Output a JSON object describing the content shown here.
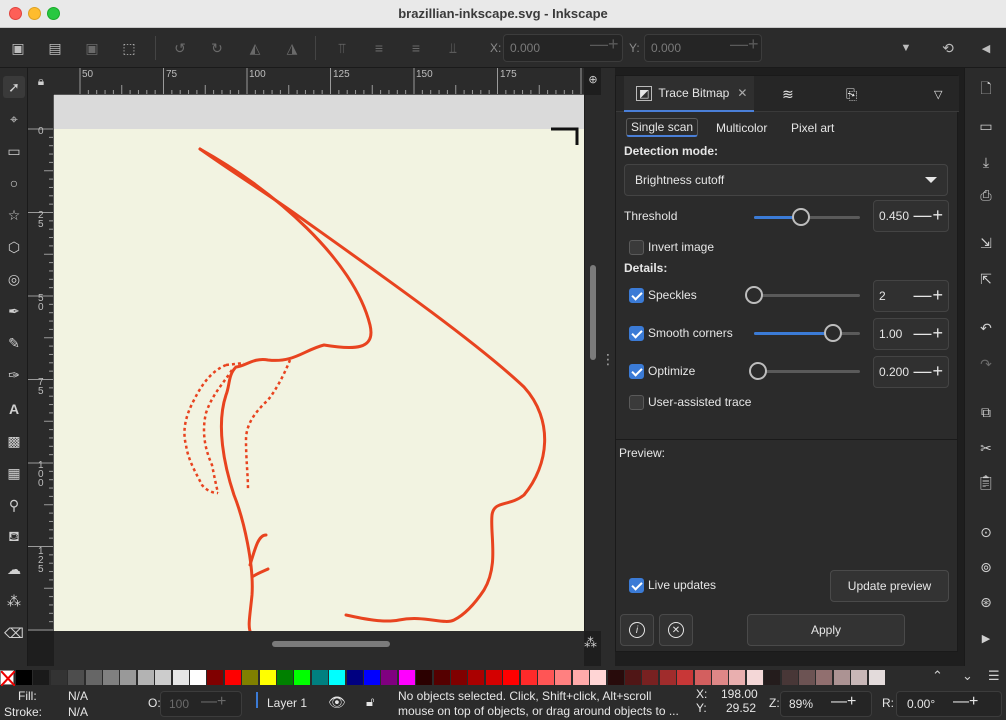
{
  "window": {
    "title": "brazillian-inkscape.svg - Inkscape"
  },
  "toolbar": {
    "x_label": "X:",
    "x_value": "0.000",
    "y_label": "Y:",
    "y_value": "0.000"
  },
  "rulers": {
    "top_ticks": [
      "50",
      "75",
      "100",
      "125",
      "150",
      "175"
    ],
    "left_ticks": [
      "0",
      "2 5",
      "5 0",
      "7 5",
      "1 0 0",
      "1 2 5"
    ]
  },
  "dock": {
    "active_tab": "Trace Bitmap",
    "subtabs": [
      "Single scan",
      "Multicolor",
      "Pixel art"
    ],
    "active_subtab": "Single scan",
    "detection_mode_label": "Detection mode:",
    "detection_mode_value": "Brightness cutoff",
    "threshold_label": "Threshold",
    "threshold_value": "0.450",
    "invert_image_label": "Invert image",
    "invert_image_checked": false,
    "details_label": "Details:",
    "speckles_label": "Speckles",
    "speckles_value": "2",
    "speckles_checked": true,
    "smooth_corners_label": "Smooth corners",
    "smooth_corners_value": "1.00",
    "smooth_corners_checked": true,
    "optimize_label": "Optimize",
    "optimize_value": "0.200",
    "optimize_checked": true,
    "user_assisted_label": "User-assisted trace",
    "user_assisted_checked": false,
    "preview_label": "Preview:",
    "live_updates_label": "Live updates",
    "live_updates_checked": true,
    "update_preview_label": "Update preview",
    "apply_label": "Apply"
  },
  "statusbar": {
    "fill_label": "Fill:",
    "fill_value": "N/A",
    "stroke_label": "Stroke:",
    "stroke_value": "N/A",
    "opacity_label": "O:",
    "opacity_value": "100",
    "layer_name": "Layer 1",
    "message_line1": "No objects selected. Click, Shift+click, Alt+scroll",
    "message_line2": "mouse on top of objects, or drag around objects to ...",
    "x_label": "X:",
    "x_value": "198.00",
    "y_label": "Y:",
    "y_value": "29.52",
    "zoom_label": "Z:",
    "zoom_value": "89%",
    "rotation_label": "R:",
    "rotation_value": "0.00°"
  },
  "colors": {
    "accent": "#3b7bd6",
    "trace_stroke": "#e8431f",
    "canvas_paper": "#f1f2e0"
  },
  "palette": [
    "#000000",
    "#1a1a1a",
    "#333333",
    "#4d4d4d",
    "#666666",
    "#808080",
    "#999999",
    "#b3b3b3",
    "#cccccc",
    "#e6e6e6",
    "#ffffff",
    "#800000",
    "#ff0000",
    "#808000",
    "#ffff00",
    "#008000",
    "#00ff00",
    "#008080",
    "#00ffff",
    "#000080",
    "#0000ff",
    "#800080",
    "#ff00ff",
    "#2b0000",
    "#550000",
    "#800000",
    "#aa0000",
    "#d40000",
    "#ff0000",
    "#ff2a2a",
    "#ff5555",
    "#ff8080",
    "#ffaaaa",
    "#ffd5d5",
    "#280b0b",
    "#501616",
    "#782121",
    "#a02c2c",
    "#c83737",
    "#d35f5f",
    "#de8787",
    "#e9afaf",
    "#f4d7d7",
    "#241c1c",
    "#483737",
    "#6c5353",
    "#916f6f",
    "#ac9393",
    "#c8b7b7",
    "#e3dbdb"
  ]
}
